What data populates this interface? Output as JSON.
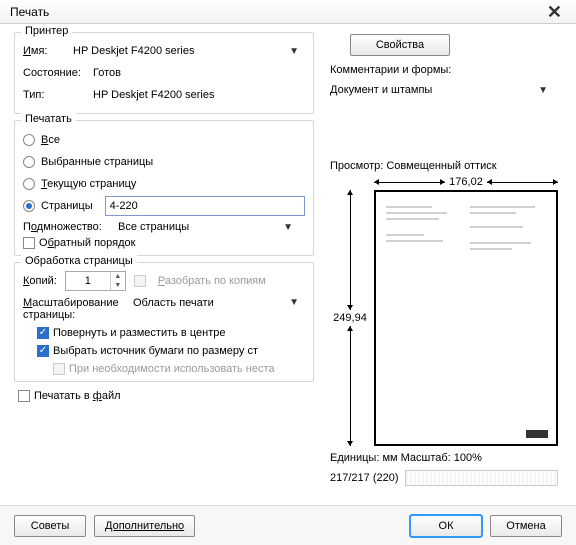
{
  "window": {
    "title": "Печать"
  },
  "printer_group": {
    "title": "Принтер",
    "name_label": "Имя:",
    "name_value": "HP Deskjet F4200 series",
    "state_label": "Состояние:",
    "state_value": "Готов",
    "type_label": "Тип:",
    "type_value": "HP Deskjet F4200 series"
  },
  "properties_btn": "Свойства",
  "comments": {
    "label": "Комментарии и формы:",
    "value": "Документ и штампы"
  },
  "range_group": {
    "title": "Печатать",
    "all": "Все",
    "selected": "Выбранные страницы",
    "current": "Текущую страницу",
    "pages": "Страницы",
    "pages_value": "4-220",
    "subset_label": "Подмножество:",
    "subset_value": "Все страницы",
    "reverse": "Обратный порядок"
  },
  "proc_group": {
    "title": "Обработка страницы",
    "copies_label": "Копий:",
    "copies_value": "1",
    "collate": "Разобрать по копиям",
    "scale_label": "Масштабирование страницы:",
    "scale_value": "Область печати",
    "rotate": "Повернуть и разместить в центре",
    "paper_src": "Выбрать источник бумаги по размеру ст",
    "custom_paper": "При необходимости использовать неста"
  },
  "print_to_file": "Печатать в файл",
  "preview": {
    "title": "Просмотр: Совмещенный оттиск",
    "width": "176,02",
    "height": "249,94",
    "units": "Единицы: мм Масштаб: 100%",
    "status": "217/217 (220)"
  },
  "buttons": {
    "tips": "Советы",
    "advanced": "Дополнительно",
    "ok": "ОК",
    "cancel": "Отмена"
  }
}
